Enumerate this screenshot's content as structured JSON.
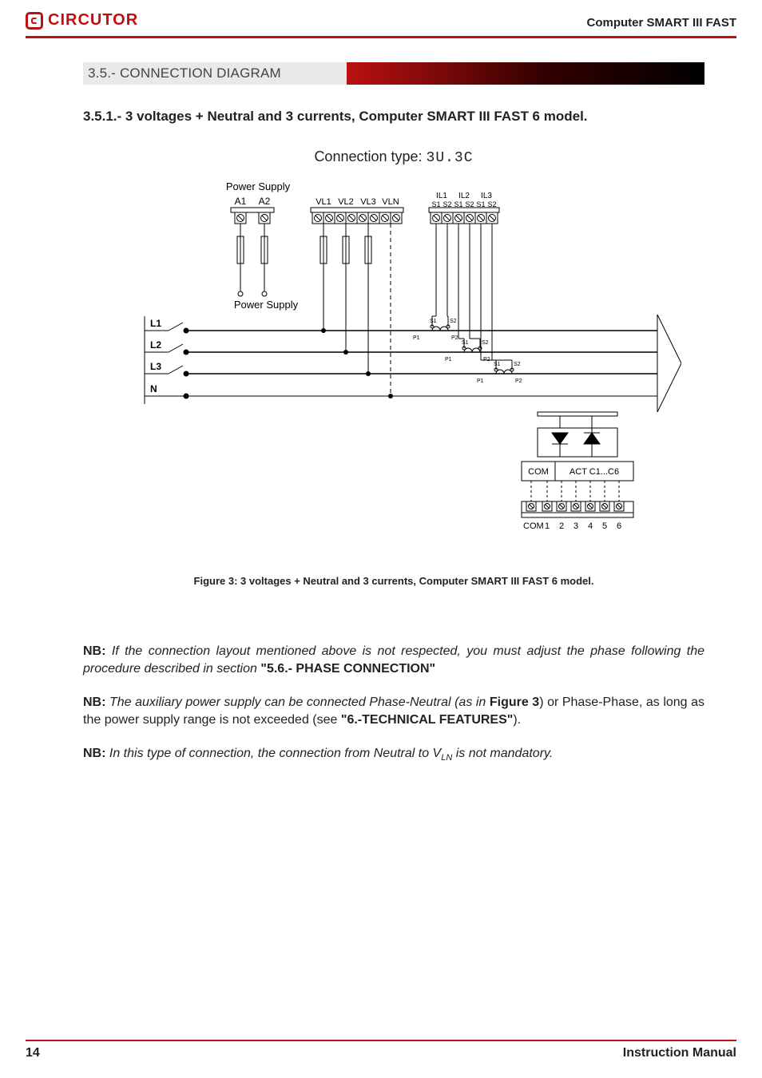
{
  "header": {
    "brand": "CIRCUTOR",
    "doc_title": "Computer SMART III FAST"
  },
  "section": {
    "number_title": "3.5.- CONNECTION DIAGRAM"
  },
  "subsection": {
    "title": "3.5.1.- 3 voltages + Neutral and 3 currents, Computer SMART III FAST 6 model."
  },
  "connection_type": {
    "label": "Connection type: ",
    "value": "3U.3C"
  },
  "diagram": {
    "power_supply_top": "Power Supply",
    "power_supply_bottom": "Power Supply",
    "a1": "A1",
    "a2": "A2",
    "vl1": "VL1",
    "vl2": "VL2",
    "vl3": "VL3",
    "vln": "VLN",
    "il1": "IL1",
    "il2": "IL2",
    "il3": "IL3",
    "s1": "S1",
    "s2": "S2",
    "p1": "P1",
    "p2": "P2",
    "l1": "L1",
    "l2": "L2",
    "l3": "L3",
    "n": "N",
    "com": "COM",
    "act": "ACT C1...C6",
    "out1": "1",
    "out2": "2",
    "out3": "3",
    "out4": "4",
    "out5": "5",
    "out6": "6"
  },
  "figure_caption": "Figure 3: 3 voltages + Neutral and 3 currents, Computer SMART III FAST 6 model.",
  "notes": {
    "n1_lead": "NB:",
    "n1_italic": " If the connection layout mentioned above is not respected, you must adjust the phase following the procedure described in section ",
    "n1_bold": "\"5.6.- PHASE CONNECTION\"",
    "n2_lead": "NB:",
    "n2_italic": " The auxiliary power supply can be connected Phase-Neutral (as in ",
    "n2_fig": "Figure 3",
    "n2_tail1": ") or Phase-Phase, as long as the power supply range is not exceeded (see ",
    "n2_bold": "\"6.-TECHNICAL FEATURES\"",
    "n2_tail2": ").",
    "n3_lead": "NB:",
    "n3_italic_a": " In this type of connection, the connection from Neutral to V",
    "n3_sub": "LN",
    "n3_italic_b": " is not mandatory."
  },
  "footer": {
    "page": "14",
    "label": "Instruction Manual"
  }
}
